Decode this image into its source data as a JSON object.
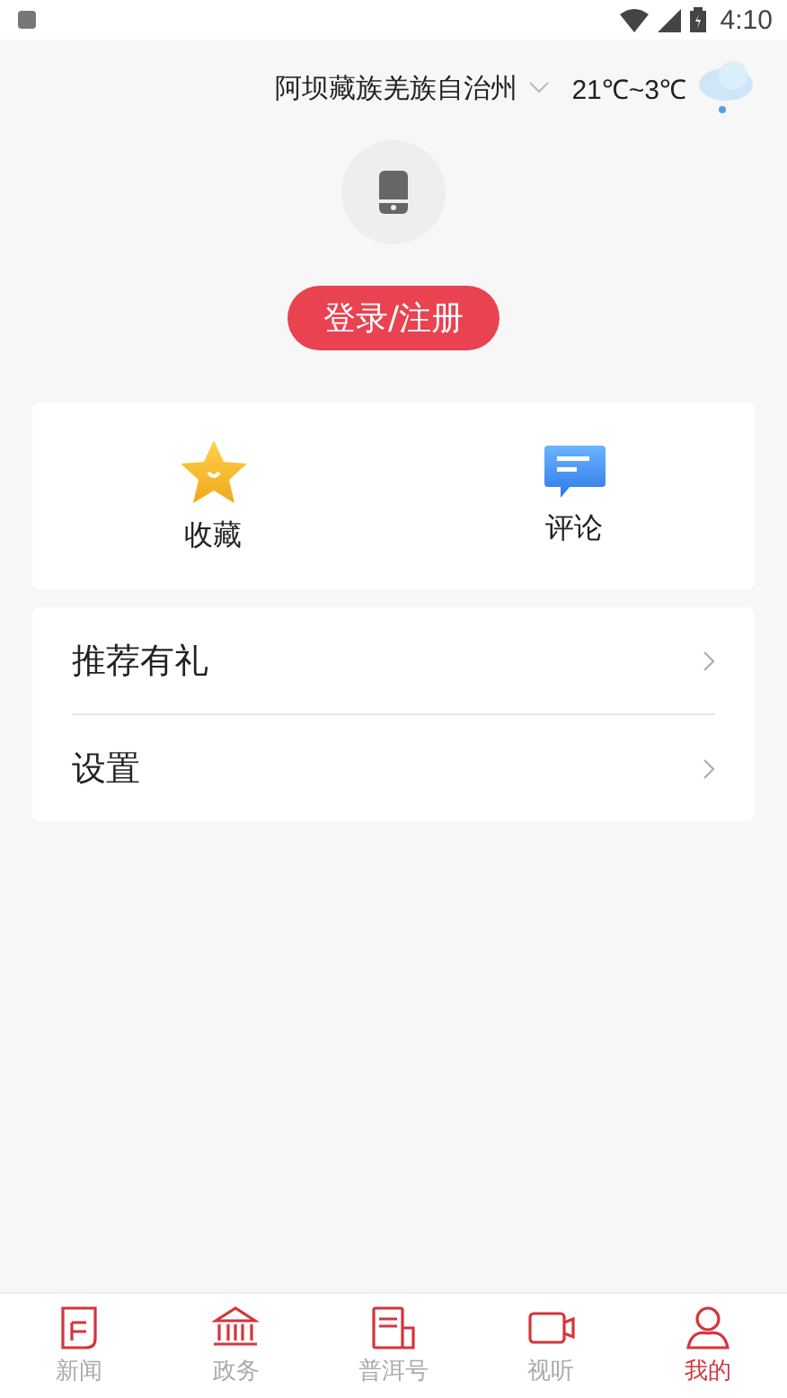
{
  "status_bar": {
    "time": "4:10"
  },
  "header": {
    "location": "阿坝藏族羌族自治州",
    "temperature": "21℃~3℃"
  },
  "login_button": "登录/注册",
  "shortcuts": [
    {
      "kind": "star",
      "label": "收藏"
    },
    {
      "kind": "comment",
      "label": "评论"
    }
  ],
  "menu": [
    {
      "label": "推荐有礼"
    },
    {
      "label": "设置"
    }
  ],
  "tabs": [
    {
      "kind": "news",
      "label": "新闻",
      "selected": false
    },
    {
      "kind": "gov",
      "label": "政务",
      "selected": false
    },
    {
      "kind": "media",
      "label": "普洱号",
      "selected": false
    },
    {
      "kind": "video",
      "label": "视听",
      "selected": false
    },
    {
      "kind": "me",
      "label": "我的",
      "selected": true
    }
  ]
}
